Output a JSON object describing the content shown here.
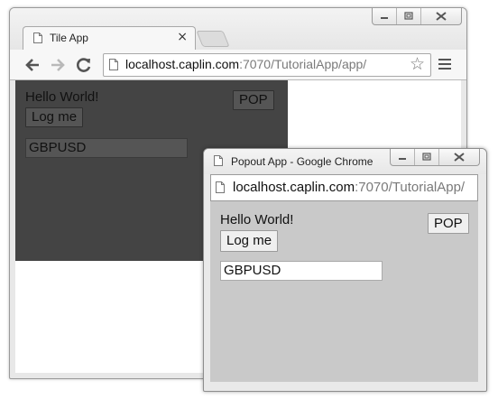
{
  "main_window": {
    "tab_title": "Tile App",
    "tab_close": "×",
    "url_host": "localhost.caplin.com",
    "url_path": ":7070/TutorialApp/app/",
    "star_icon": "☆"
  },
  "tile_app": {
    "greeting": "Hello World!",
    "login_label": "Log me",
    "pop_label": "POP",
    "currency_value": "GBPUSD"
  },
  "popout_window": {
    "title": "Popout App - Google Chrome",
    "url_host": "localhost.caplin.com",
    "url_path": ":7070/TutorialApp/",
    "greeting": "Hello World!",
    "login_label": "Log me",
    "pop_label": "POP",
    "currency_value": "GBPUSD"
  },
  "colors": {
    "tile_background": "#444444",
    "popout_background": "#c9c9c9",
    "chrome_frame": "#e8e8e8"
  }
}
